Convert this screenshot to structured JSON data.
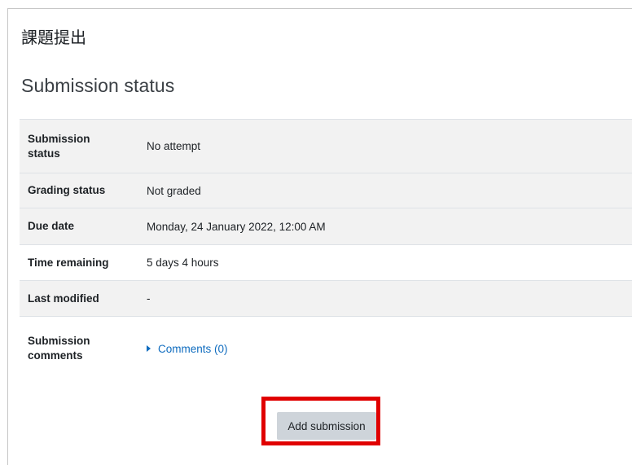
{
  "page_title": "課題提出",
  "section_title": "Submission status",
  "rows": [
    {
      "label_line1": "Submission",
      "label_line2": "status",
      "value": "No attempt"
    },
    {
      "label": "Grading status",
      "value": "Not graded"
    },
    {
      "label": "Due date",
      "value": "Monday, 24 January 2022, 12:00 AM"
    },
    {
      "label": "Time remaining",
      "value": "5 days 4 hours"
    },
    {
      "label": "Last modified",
      "value": "-"
    },
    {
      "label_line1": "Submission",
      "label_line2": "comments",
      "comments_link": "Comments (0)"
    }
  ],
  "add_submission_label": "Add submission",
  "colors": {
    "highlight": "#e00000",
    "link": "#0f6cbf",
    "button": "#ced4da"
  }
}
